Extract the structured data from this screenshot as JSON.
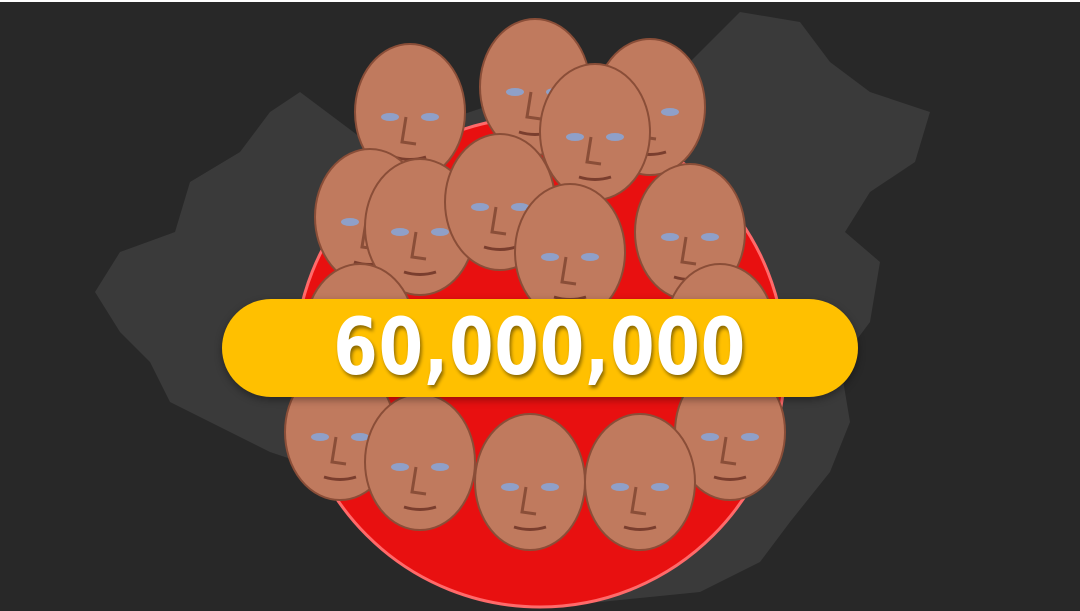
{
  "counter": {
    "value": "60,000,000"
  },
  "colors": {
    "background": "#282828",
    "map": "#3a3a3a",
    "circle": "#e81010",
    "banner": "#ffc000",
    "skin": "#c07a5e"
  }
}
